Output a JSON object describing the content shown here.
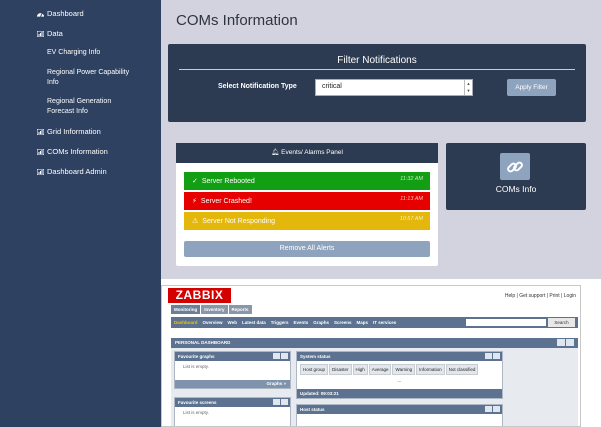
{
  "sidebar": {
    "items": [
      {
        "label": "Dashboard",
        "icon": "dashboard-icon"
      },
      {
        "label": "Data",
        "icon": "chart-icon"
      },
      {
        "label": "EV Charging Info"
      },
      {
        "label": "Regional Power Capability Info"
      },
      {
        "label": "Regional Generation Forecast Info"
      },
      {
        "label": "Grid Information",
        "icon": "chart-icon"
      },
      {
        "label": "COMs Information",
        "icon": "chart-icon"
      },
      {
        "label": "Dashboard Admin",
        "icon": "chart-icon"
      }
    ]
  },
  "main": {
    "title": "COMs Information",
    "filter": {
      "title": "Filter Notifications",
      "label": "Select Notification Type",
      "selected": "critical",
      "apply_label": "Apply Filter"
    },
    "events": {
      "header": "Events/ Alarms Panel",
      "alerts": [
        {
          "text": "Server Rebooted",
          "time": "11:32 AM",
          "color": "#139f13",
          "icon": "check-circle-icon"
        },
        {
          "text": "Server Crashed!",
          "time": "11:13 AM",
          "color": "#e60000",
          "icon": "bolt-icon"
        },
        {
          "text": "Server Not Responding",
          "time": "10:57 AM",
          "color": "#e3b70b",
          "icon": "warning-icon"
        }
      ],
      "remove_label": "Remove All Alerts"
    },
    "coms_card": {
      "label": "COMs Info",
      "icon": "link-icon"
    }
  },
  "zabbix": {
    "logo": "ZABBIX",
    "toplinks": "Help | Get support | Print | Login",
    "tabs": [
      "Monitoring",
      "Inventory",
      "Reports"
    ],
    "nav": [
      "Dashboard",
      "Overview",
      "Web",
      "Latest data",
      "Triggers",
      "Events",
      "Graphs",
      "Screens",
      "Maps",
      "IT services"
    ],
    "search_label": "Search",
    "personal_dashboard": "PERSONAL DASHBOARD",
    "fav_graphs": {
      "title": "Favourite graphs",
      "empty": "List is empty.",
      "footer": "Graphs »"
    },
    "fav_screens": {
      "title": "Favourite screens",
      "empty": "List is empty."
    },
    "system_status": {
      "title": "System status",
      "columns": [
        "Host group",
        "Disaster",
        "High",
        "Average",
        "Warning",
        "Information",
        "Not classified"
      ],
      "dots": "...",
      "updated": "Updated: 09:03:21"
    },
    "host_status": {
      "title": "Host status"
    }
  },
  "colors": {
    "sidebar_bg": "#2e4160",
    "panel_bg": "#2d3b52",
    "button_bg": "#8ea3bd",
    "content_bg": "#d2d3df"
  }
}
